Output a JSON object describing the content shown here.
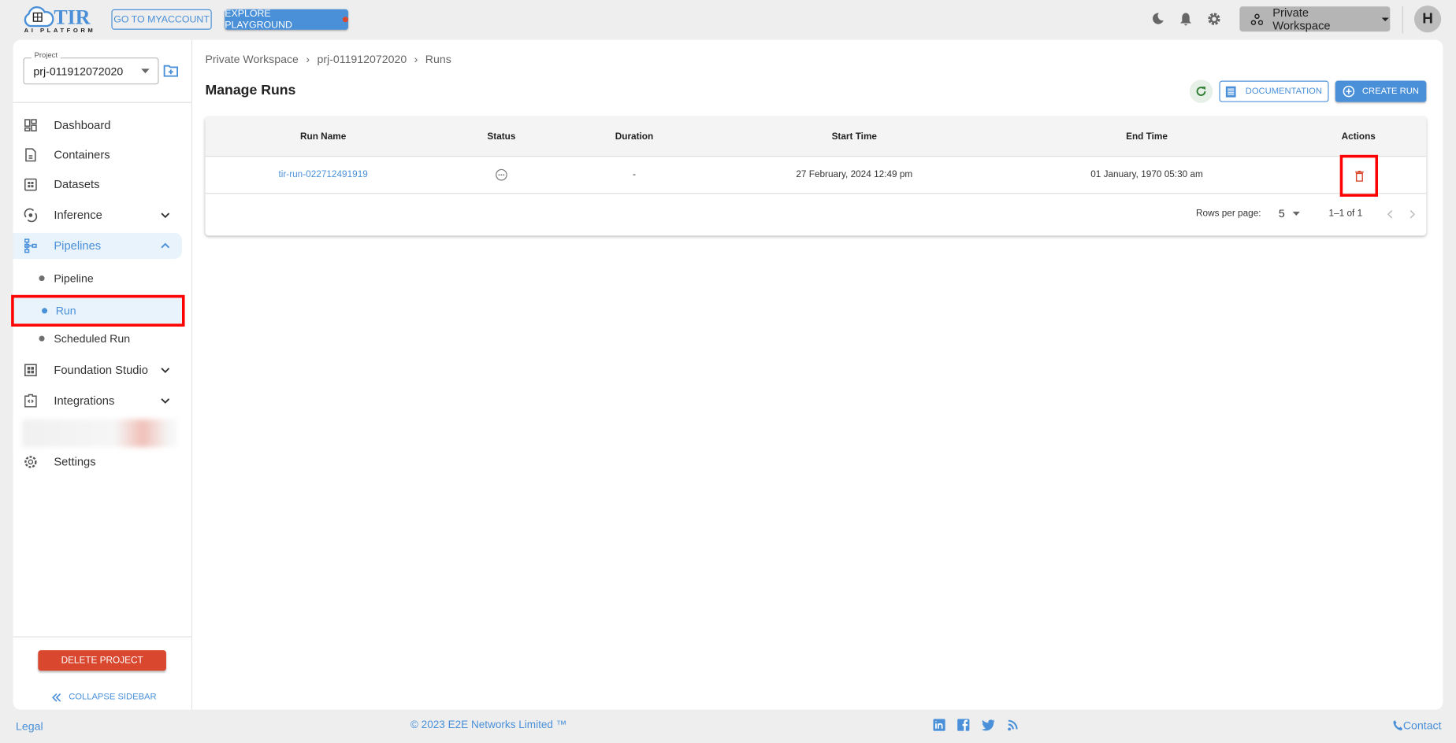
{
  "topbar": {
    "logo_text": "TIR",
    "logo_sub": "AI PLATFORM",
    "myaccount_label": "GO TO MYACCOUNT",
    "playground_label": "EXPLORE PLAYGROUND",
    "workspace_label": "Private Workspace",
    "avatar_letter": "H"
  },
  "sidebar": {
    "project_label": "Project",
    "project_value": "prj-011912072020",
    "items": [
      {
        "label": "Dashboard",
        "icon": "dashboard-icon"
      },
      {
        "label": "Containers",
        "icon": "file-icon"
      },
      {
        "label": "Datasets",
        "icon": "grid-icon"
      },
      {
        "label": "Inference",
        "icon": "inference-icon"
      },
      {
        "label": "Pipelines",
        "icon": "pipeline-icon"
      },
      {
        "label": "Foundation Studio",
        "icon": "studio-icon"
      },
      {
        "label": "Integrations",
        "icon": "integration-icon"
      },
      {
        "label": "Settings",
        "icon": "gear-icon"
      }
    ],
    "sub_items": [
      {
        "label": "Pipeline"
      },
      {
        "label": "Run",
        "active": true
      },
      {
        "label": "Scheduled Run"
      }
    ],
    "delete_label": "DELETE PROJECT",
    "collapse_label": "COLLAPSE SIDEBAR"
  },
  "main": {
    "breadcrumb": [
      "Private Workspace",
      "prj-011912072020",
      "Runs"
    ],
    "title": "Manage Runs",
    "documentation_label": "DOCUMENTATION",
    "create_label": "CREATE RUN",
    "table": {
      "columns": [
        "Run Name",
        "Status",
        "Duration",
        "Start Time",
        "End Time",
        "Actions"
      ],
      "rows": [
        {
          "run_name": "tir-run-022712491919",
          "status": "pending-icon",
          "duration": "-",
          "start": "27 February, 2024 12:49 pm",
          "end": "01 January, 1970 05:30 am"
        }
      ],
      "rows_per_page_label": "Rows per page:",
      "rows_per_page": "5",
      "range": "1–1 of 1"
    }
  },
  "footer": {
    "legal": "Legal",
    "copyright": "© 2023 E2E Networks Limited ™",
    "contact": "Contact"
  },
  "colors": {
    "accent": "#4a90d9",
    "danger": "#d9472f",
    "highlight": "#e8f3fb"
  }
}
